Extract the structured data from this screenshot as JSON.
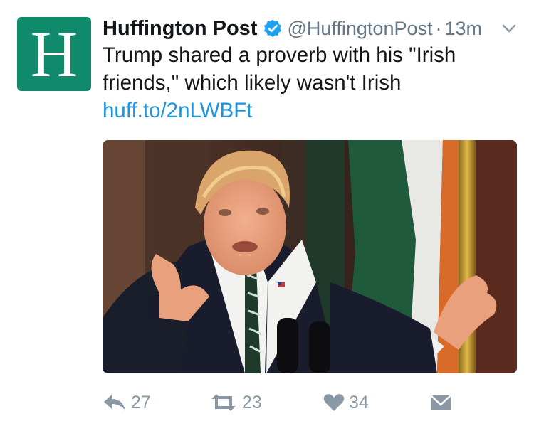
{
  "account": {
    "avatar_letter": "H",
    "avatar_color": "#0f8a6a",
    "name": "Huffington Post",
    "handle": "@HuffingtonPost",
    "separator": "·",
    "time": "13m",
    "verified_icon": "verified-badge-icon",
    "menu_icon": "chevron-down-icon"
  },
  "tweet": {
    "text": "Trump shared a proverb with his \"Irish friends,\" which likely wasn't Irish ",
    "link": "huff.to/2nLWBFt",
    "link_color": "#1b95e0"
  },
  "media": {
    "description_icon": "photo"
  },
  "actions": {
    "reply_count": "27",
    "retweet_count": "23",
    "like_count": "34",
    "icon_color": "#8a98a5"
  }
}
